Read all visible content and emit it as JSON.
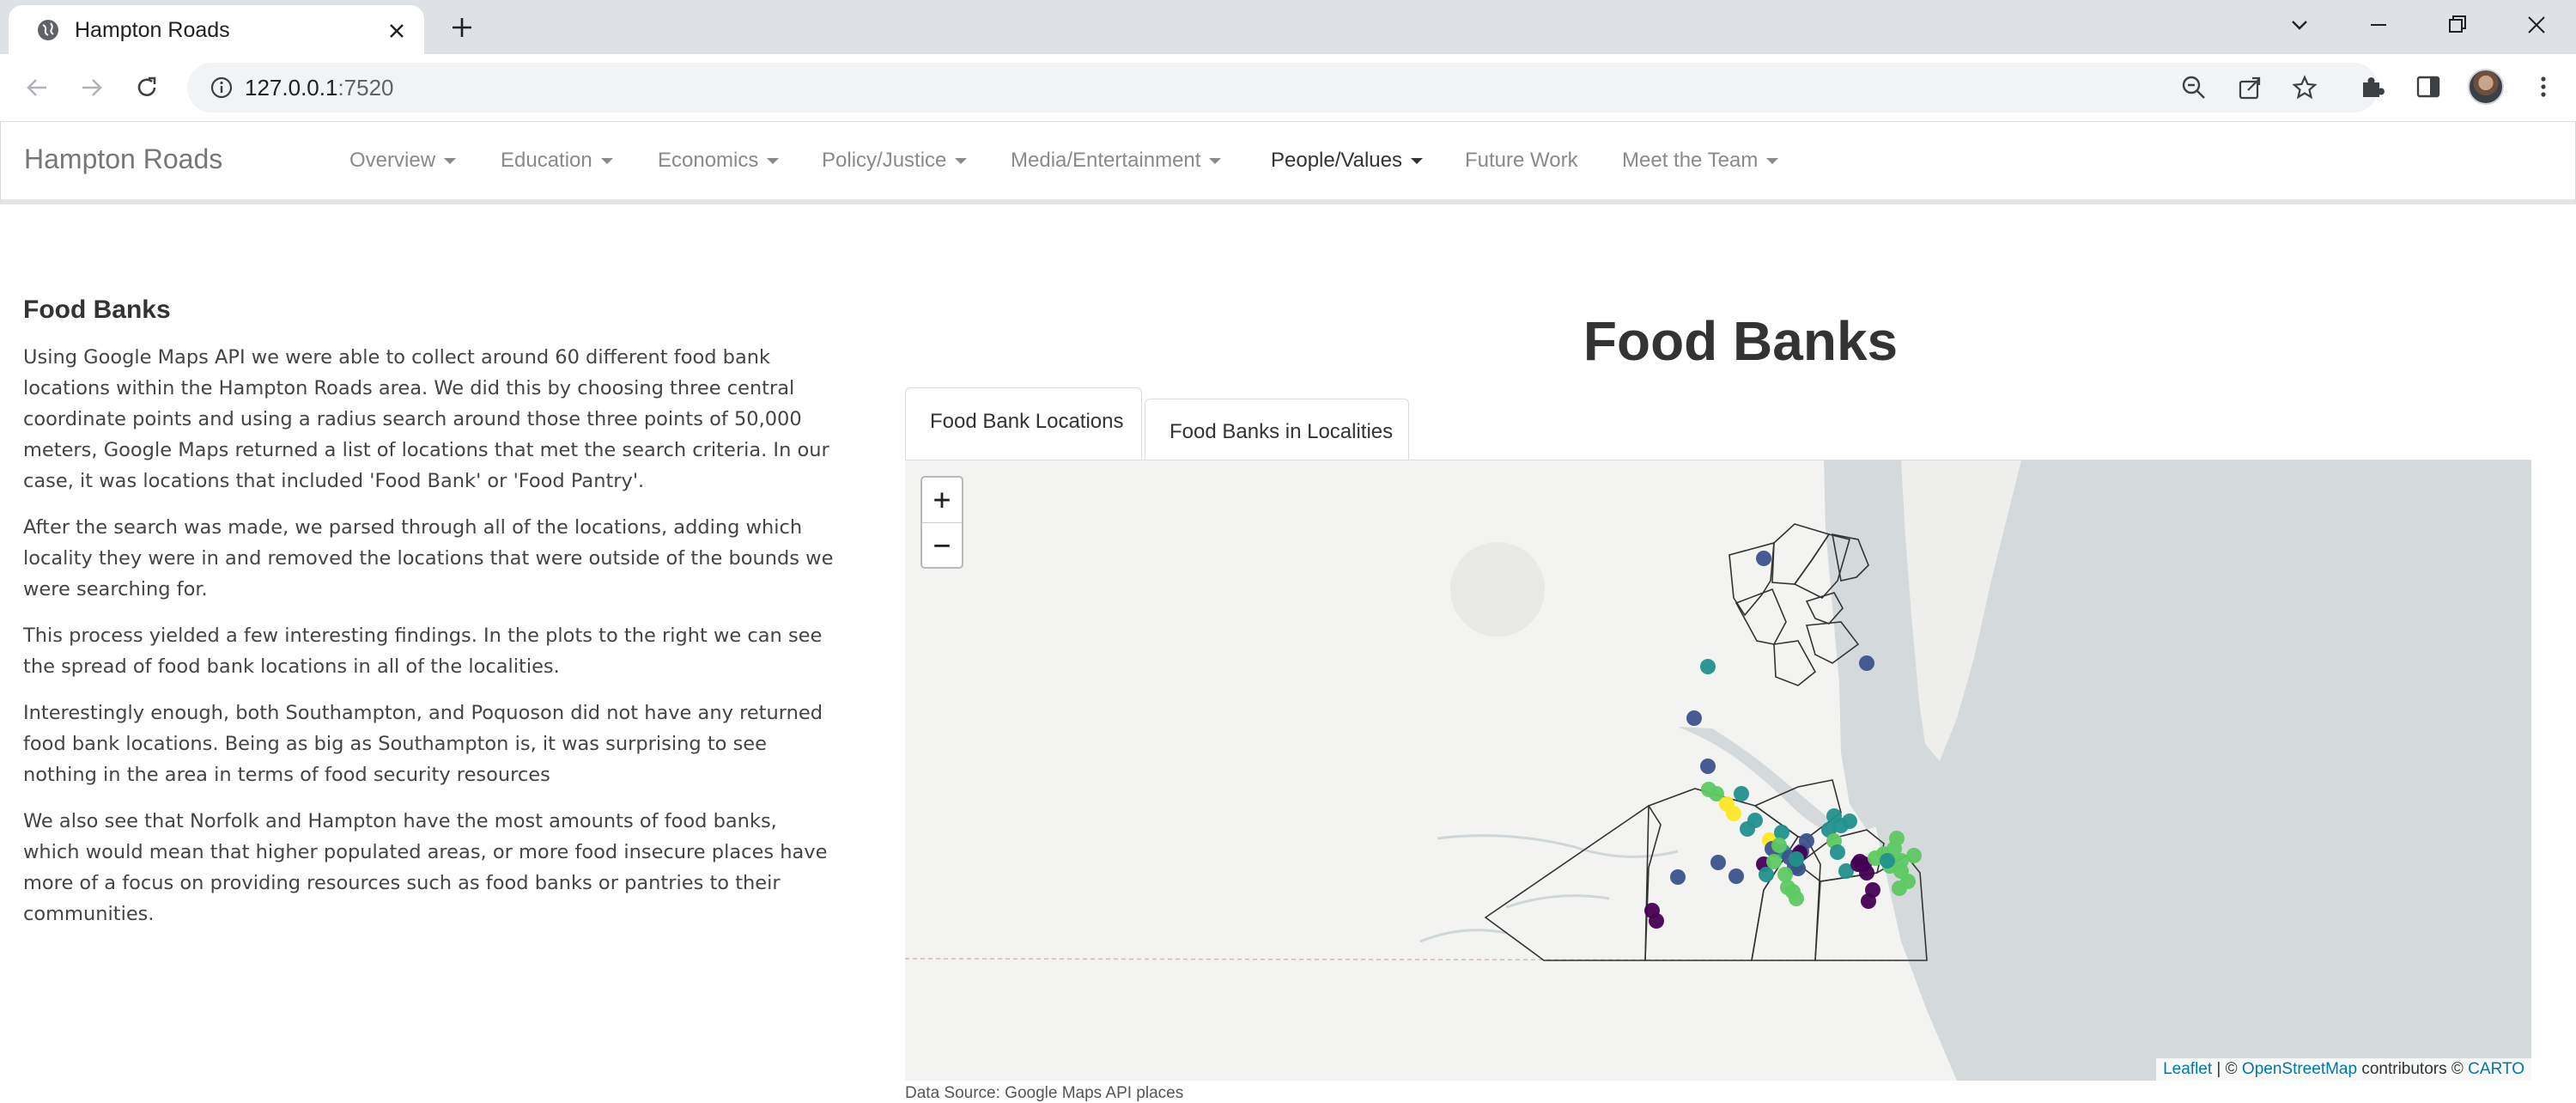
{
  "browser": {
    "tab_title": "Hampton Roads",
    "url_host": "127.0.0.1",
    "url_port": ":7520"
  },
  "navbar": {
    "brand": "Hampton Roads",
    "menu": [
      {
        "label": "Overview",
        "dropdown": true,
        "active": false
      },
      {
        "label": "Education",
        "dropdown": true,
        "active": false
      },
      {
        "label": "Economics",
        "dropdown": true,
        "active": false
      },
      {
        "label": "Policy/Justice",
        "dropdown": true,
        "active": false
      },
      {
        "label": "Media/Entertainment",
        "dropdown": true,
        "active": false
      },
      {
        "label": "People/Values",
        "dropdown": true,
        "active": true
      },
      {
        "label": "Future Work",
        "dropdown": false,
        "active": false
      },
      {
        "label": "Meet the Team",
        "dropdown": true,
        "active": false
      }
    ]
  },
  "left": {
    "heading": "Food Banks",
    "paragraphs": [
      "Using Google Maps API we were able to collect around 60 different food bank locations within the Hampton Roads area. We did this by choosing three central coordinate points and using a radius search around those three points of 50,000 meters, Google Maps returned a list of locations that met the search criteria. In our case, it was locations that included 'Food Bank' or 'Food Pantry'.",
      "After the search was made, we parsed through all of the locations, adding which locality they were in and removed the locations that were outside of the bounds we were searching for.",
      "This process yielded a few interesting findings. In the plots to the right we can see the spread of food bank locations in all of the localities.",
      "Interestingly enough, both Southampton, and Poquoson did not have any returned food bank locations. Being as big as Southampton is, it was surprising to see nothing in the area in terms of food security resources",
      "We also see that Norfolk and Hampton have the most amounts of food banks, which would mean that higher populated areas, or more food insecure places have more of a focus on providing resources such as food banks or pantries to their communities."
    ]
  },
  "main": {
    "title": "Food Banks",
    "tabs": [
      {
        "label": "Food Bank Locations",
        "active": true
      },
      {
        "label": "Food Banks in Localities",
        "active": false
      }
    ],
    "map": {
      "zoom_in": "+",
      "zoom_out": "−",
      "attribution": {
        "leaflet": "Leaflet",
        "sep": " | © ",
        "osm": "OpenStreetMap",
        "contrib": " contributors © ",
        "carto": "CARTO"
      },
      "marker_palette": [
        "#440154",
        "#3b528b",
        "#21918c",
        "#5ec962",
        "#fde725"
      ],
      "water_color": "#d4dadc",
      "land_color": "#f3f3f2"
    },
    "caption": "Data Source: Google Maps API places"
  }
}
